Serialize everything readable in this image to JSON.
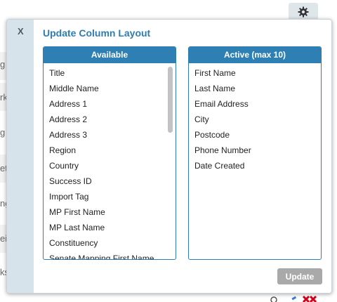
{
  "background": {
    "row_fragments": [
      "g",
      "rk",
      "g",
      "et",
      "ng",
      "ei",
      "ks"
    ]
  },
  "modal": {
    "close_label": "X",
    "title": "Update Column Layout",
    "available": {
      "header": "Available",
      "items": [
        "Title",
        "Middle Name",
        "Address 1",
        "Address 2",
        "Address 3",
        "Region",
        "Country",
        "Success ID",
        "Import Tag",
        "MP First Name",
        "MP Last Name",
        "Constituency",
        "Senate Mapping First Name"
      ]
    },
    "active": {
      "header": "Active (max 10)",
      "items": [
        "First Name",
        "Last Name",
        "Email Address",
        "City",
        "Postcode",
        "Phone Number",
        "Date Created"
      ]
    },
    "update_label": "Update"
  },
  "icons": {
    "settings": "gear-icon",
    "search": "search-icon",
    "edit": "pencil-icon",
    "delete": "delete-icon"
  },
  "colors": {
    "accent": "#2e80b4",
    "sidebar": "#d7e3ea",
    "button_disabled": "#a9a9a9"
  }
}
